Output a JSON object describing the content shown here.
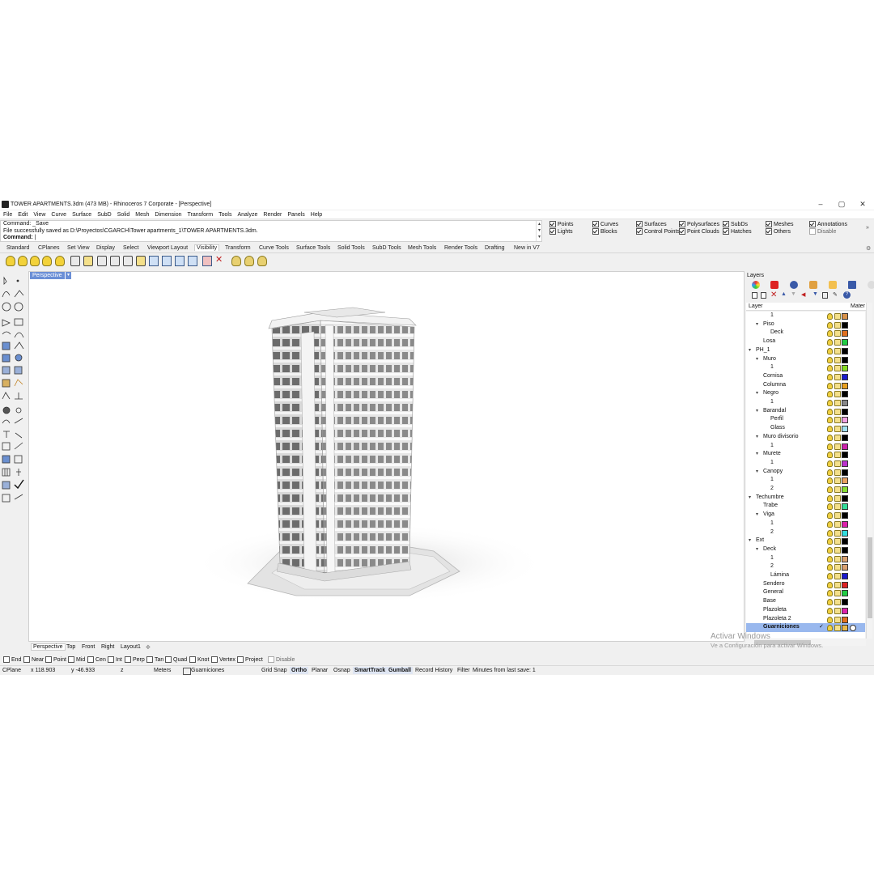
{
  "window": {
    "title": "TOWER APARTMENTS.3dm (473 MB) - Rhinoceros 7 Corporate - [Perspective]",
    "minimize": "–",
    "maximize": "▢",
    "close": "✕"
  },
  "menu": [
    "File",
    "Edit",
    "View",
    "Curve",
    "Surface",
    "SubD",
    "Solid",
    "Mesh",
    "Dimension",
    "Transform",
    "Tools",
    "Analyze",
    "Render",
    "Panels",
    "Help"
  ],
  "command": {
    "line1": "Command: _Save",
    "line2": "File successfully saved as D:\\Proyectos\\CGARCH\\Tower apartments_1\\TOWER APARTMENTS.3dm.",
    "prompt": "Command:"
  },
  "selection_filters": [
    {
      "label": "Points",
      "checked": true
    },
    {
      "label": "Lights",
      "checked": true
    },
    {
      "label": "Curves",
      "checked": true
    },
    {
      "label": "Blocks",
      "checked": true
    },
    {
      "label": "Surfaces",
      "checked": true
    },
    {
      "label": "Control Points",
      "checked": true
    },
    {
      "label": "Polysurfaces",
      "checked": true
    },
    {
      "label": "Point Clouds",
      "checked": true
    },
    {
      "label": "SubDs",
      "checked": true
    },
    {
      "label": "Hatches",
      "checked": true
    },
    {
      "label": "Meshes",
      "checked": true
    },
    {
      "label": "Others",
      "checked": true
    },
    {
      "label": "Annotations",
      "checked": true
    },
    {
      "label": "Disable",
      "checked": false
    }
  ],
  "toolbar_tabs": [
    "Standard",
    "CPlanes",
    "Set View",
    "Display",
    "Select",
    "Viewport Layout",
    "Visibility",
    "Transform",
    "Curve Tools",
    "Surface Tools",
    "Solid Tools",
    "SubD Tools",
    "Mesh Tools",
    "Render Tools",
    "Drafting",
    "New in V7"
  ],
  "active_tab": "Visibility",
  "viewport": {
    "title": "Perspective",
    "tabs": [
      "Perspective",
      "Top",
      "Front",
      "Right",
      "Layout1"
    ],
    "add_tab": "✥"
  },
  "osnaps": [
    {
      "label": "End",
      "checked": false
    },
    {
      "label": "Near",
      "checked": false
    },
    {
      "label": "Point",
      "checked": false
    },
    {
      "label": "Mid",
      "checked": false
    },
    {
      "label": "Cen",
      "checked": false
    },
    {
      "label": "Int",
      "checked": false
    },
    {
      "label": "Perp",
      "checked": false
    },
    {
      "label": "Tan",
      "checked": false
    },
    {
      "label": "Quad",
      "checked": false
    },
    {
      "label": "Knot",
      "checked": false
    },
    {
      "label": "Vertex",
      "checked": false
    },
    {
      "label": "Project",
      "checked": false
    },
    {
      "label": "Disable",
      "checked": false
    }
  ],
  "status": {
    "cplane": "CPlane",
    "x": "x 118.903",
    "y": "y -46.933",
    "z": "z",
    "units": "Meters",
    "layer": "Guarniciones",
    "layer_color": "#e8b84a",
    "grid_snap": "Grid Snap",
    "ortho": "Ortho",
    "planar": "Planar",
    "osnap": "Osnap",
    "smarttrack": "SmartTrack",
    "gumball": "Gumball",
    "record_history": "Record History",
    "filter": "Filter",
    "last_save": "Minutes from last save: 1"
  },
  "layers_panel": {
    "title": "Layers",
    "col_layer": "Layer",
    "col_material": "Mater",
    "rows": [
      {
        "name": "1",
        "depth": 3,
        "caret": "",
        "color": "#d8924a"
      },
      {
        "name": "Piso",
        "depth": 2,
        "caret": "▾",
        "color": "#000000"
      },
      {
        "name": "Deck",
        "depth": 3,
        "caret": "",
        "color": "#e07020"
      },
      {
        "name": "Losa",
        "depth": 2,
        "caret": "",
        "color": "#22cc44"
      },
      {
        "name": "PH_1",
        "depth": 1,
        "caret": "▾",
        "color": "#000000"
      },
      {
        "name": "Muro",
        "depth": 2,
        "caret": "▾",
        "color": "#000000"
      },
      {
        "name": "1",
        "depth": 3,
        "caret": "",
        "color": "#88dd22"
      },
      {
        "name": "Cornisa",
        "depth": 2,
        "caret": "",
        "color": "#1a1acc"
      },
      {
        "name": "Columna",
        "depth": 2,
        "caret": "",
        "color": "#e8a020"
      },
      {
        "name": "Negro",
        "depth": 2,
        "caret": "▾",
        "color": "#000000"
      },
      {
        "name": "1",
        "depth": 3,
        "caret": "",
        "color": "#888888"
      },
      {
        "name": "Barandal",
        "depth": 2,
        "caret": "▾",
        "color": "#000000"
      },
      {
        "name": "Perfil",
        "depth": 3,
        "caret": "",
        "color": "#f0a0e0"
      },
      {
        "name": "Glass",
        "depth": 3,
        "caret": "",
        "color": "#a0e0f0"
      },
      {
        "name": "Muro divisorio",
        "depth": 2,
        "caret": "▾",
        "color": "#000000"
      },
      {
        "name": "1",
        "depth": 3,
        "caret": "",
        "color": "#cc22aa"
      },
      {
        "name": "Murete",
        "depth": 2,
        "caret": "▾",
        "color": "#000000"
      },
      {
        "name": "1",
        "depth": 3,
        "caret": "",
        "color": "#bb33cc"
      },
      {
        "name": "Canopy",
        "depth": 2,
        "caret": "▾",
        "color": "#000000"
      },
      {
        "name": "1",
        "depth": 3,
        "caret": "",
        "color": "#e8a060"
      },
      {
        "name": "2",
        "depth": 3,
        "caret": "",
        "color": "#88dd33"
      },
      {
        "name": "Techumbre",
        "depth": 1,
        "caret": "▾",
        "color": "#000000"
      },
      {
        "name": "Trabe",
        "depth": 2,
        "caret": "",
        "color": "#33dd99"
      },
      {
        "name": "Viga",
        "depth": 2,
        "caret": "▾",
        "color": "#000000"
      },
      {
        "name": "1",
        "depth": 3,
        "caret": "",
        "color": "#dd22aa"
      },
      {
        "name": "2",
        "depth": 3,
        "caret": "",
        "color": "#33dddd"
      },
      {
        "name": "Ext",
        "depth": 1,
        "caret": "▾",
        "color": "#000000"
      },
      {
        "name": "Deck",
        "depth": 2,
        "caret": "▾",
        "color": "#000000"
      },
      {
        "name": "1",
        "depth": 3,
        "caret": "",
        "color": "#d8a070"
      },
      {
        "name": "2",
        "depth": 3,
        "caret": "",
        "color": "#d8a070"
      },
      {
        "name": "Lámina",
        "depth": 3,
        "caret": "",
        "color": "#1a1acc"
      },
      {
        "name": "Sendero",
        "depth": 2,
        "caret": "",
        "color": "#dd2222"
      },
      {
        "name": "General",
        "depth": 2,
        "caret": "",
        "color": "#22cc44"
      },
      {
        "name": "Base",
        "depth": 2,
        "caret": "",
        "color": "#000000"
      },
      {
        "name": "Plazoleta",
        "depth": 2,
        "caret": "",
        "color": "#dd22aa"
      },
      {
        "name": "Plazoleta 2",
        "depth": 2,
        "caret": "",
        "color": "#e07020"
      },
      {
        "name": "Guarniciones",
        "depth": 2,
        "caret": "",
        "color": "#e8b84a",
        "selected": true,
        "current": "✓"
      }
    ]
  },
  "watermark": {
    "line1": "Activar Windows",
    "line2": "Ve a Configuración para activar Windows."
  }
}
